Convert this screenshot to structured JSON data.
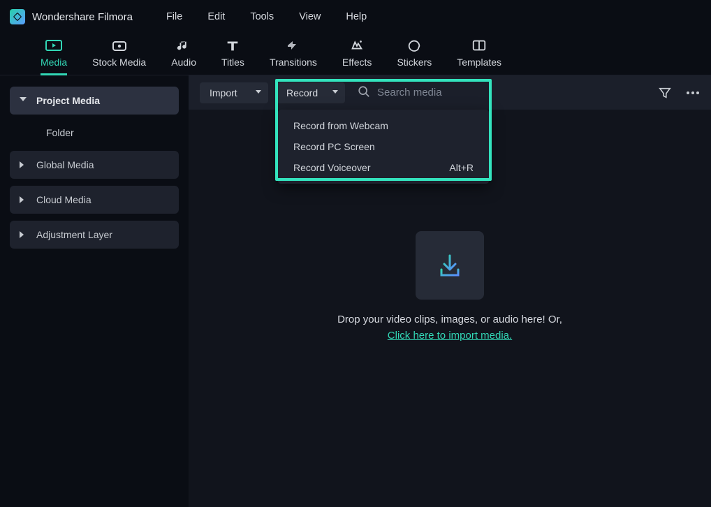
{
  "app_name": "Wondershare Filmora",
  "menubar": [
    "File",
    "Edit",
    "Tools",
    "View",
    "Help"
  ],
  "tabs": [
    {
      "label": "Media",
      "active": true,
      "icon": "media"
    },
    {
      "label": "Stock Media",
      "active": false,
      "icon": "stock"
    },
    {
      "label": "Audio",
      "active": false,
      "icon": "audio"
    },
    {
      "label": "Titles",
      "active": false,
      "icon": "titles"
    },
    {
      "label": "Transitions",
      "active": false,
      "icon": "transitions"
    },
    {
      "label": "Effects",
      "active": false,
      "icon": "effects"
    },
    {
      "label": "Stickers",
      "active": false,
      "icon": "stickers"
    },
    {
      "label": "Templates",
      "active": false,
      "icon": "templates"
    }
  ],
  "sidebar": {
    "project": {
      "label": "Project Media",
      "expanded": true,
      "children": [
        {
          "label": "Folder"
        }
      ]
    },
    "items": [
      {
        "label": "Global Media"
      },
      {
        "label": "Cloud Media"
      },
      {
        "label": "Adjustment Layer"
      }
    ]
  },
  "toolbar": {
    "import_label": "Import",
    "record_label": "Record",
    "search_placeholder": "Search media"
  },
  "record_menu": [
    {
      "label": "Record from Webcam",
      "shortcut": ""
    },
    {
      "label": "Record PC Screen",
      "shortcut": ""
    },
    {
      "label": "Record Voiceover",
      "shortcut": "Alt+R"
    }
  ],
  "drop_area": {
    "line1": "Drop your video clips, images, or audio here! Or,",
    "link": "Click here to import media."
  }
}
